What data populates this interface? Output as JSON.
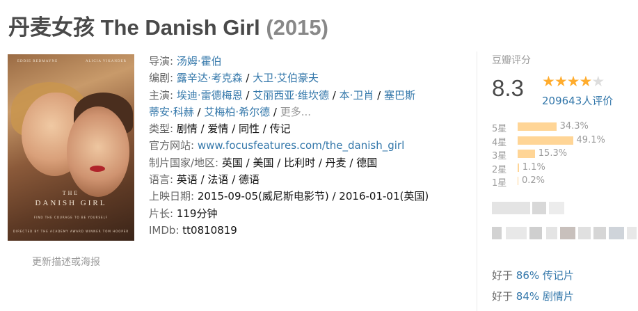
{
  "title": {
    "main": "丹麦女孩 The Danish Girl",
    "year": "(2015)"
  },
  "poster": {
    "credit_left": "EDDIE REDMAYNE",
    "credit_right": "ALICIA VIKANDER",
    "title_top": "THE",
    "title_main": "DANISH GIRL",
    "tagline": "FIND THE COURAGE TO BE YOURSELF",
    "director_line": "DIRECTED BY THE ACADEMY AWARD WINNER TOM HOOPER"
  },
  "update_link": "更新描述或海报",
  "info": {
    "director_label": "导演:",
    "director": "汤姆·霍伯",
    "writer_label": "编剧:",
    "writers": [
      "露辛达·考克森",
      "大卫·艾伯豪夫"
    ],
    "cast_label": "主演:",
    "cast_line1": [
      "埃迪·雷德梅恩",
      "艾丽西亚·维坎德",
      "本·卫肖",
      "塞巴斯"
    ],
    "cast_line2": [
      "蒂安·科赫",
      "艾梅柏·希尔德"
    ],
    "cast_more": "更多...",
    "sep": " / ",
    "genre_label": "类型:",
    "genre": "剧情 / 爱情 / 同性 / 传记",
    "website_label": "官方网站:",
    "website": "www.focusfeatures.com/the_danish_girl",
    "country_label": "制片国家/地区:",
    "country": "英国 / 美国 / 比利时 / 丹麦 / 德国",
    "language_label": "语言:",
    "language": "英语 / 法语 / 德语",
    "release_label": "上映日期:",
    "release": "2015-09-05(威尼斯电影节) / 2016-01-01(英国)",
    "runtime_label": "片长:",
    "runtime": "119分钟",
    "imdb_label": "IMDb:",
    "imdb": "tt0810819"
  },
  "rating": {
    "label": "豆瓣评分",
    "score": "8.3",
    "stars_filled": 4,
    "stars_total": 5,
    "votes": "209643人评价",
    "distribution": [
      {
        "label": "5星",
        "percent": "34.3%",
        "value": 34.3
      },
      {
        "label": "4星",
        "percent": "49.1%",
        "value": 49.1
      },
      {
        "label": "3星",
        "percent": "15.3%",
        "value": 15.3
      },
      {
        "label": "2星",
        "percent": "1.1%",
        "value": 1.1
      },
      {
        "label": "1星",
        "percent": "0.2%",
        "value": 0.2
      }
    ]
  },
  "better_than": [
    {
      "prefix": "好于 ",
      "link": "86% 传记片"
    },
    {
      "prefix": "好于 ",
      "link": "84% 剧情片"
    }
  ],
  "colors": {
    "link": "#3377aa",
    "star": "#ffac2d",
    "bar": "#ffd596"
  }
}
